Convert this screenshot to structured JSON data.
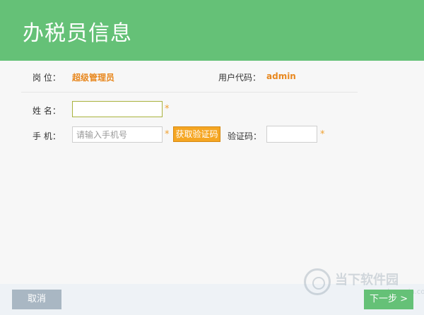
{
  "header": {
    "title": "办税员信息"
  },
  "info": {
    "position_label": "岗 位：",
    "position_value": "超级管理员",
    "usercode_label": "用户代码：",
    "usercode_value": "admin"
  },
  "form": {
    "name_label": "姓 名：",
    "name_value": "",
    "phone_label": "手 机：",
    "phone_placeholder": "请输入手机号",
    "get_code_label": "获取验证码",
    "code_label": "验证码：",
    "code_value": "",
    "required_mark": "*"
  },
  "footer": {
    "cancel_label": "取消",
    "next_label": "下一步 >"
  },
  "watermark": {
    "text": "当下软件园",
    "url": "www.downxia.com"
  },
  "colors": {
    "header_green": "#65c177",
    "accent_orange": "#e8881f",
    "button_orange": "#f5a623",
    "cancel_gray": "#a9b7c3"
  }
}
